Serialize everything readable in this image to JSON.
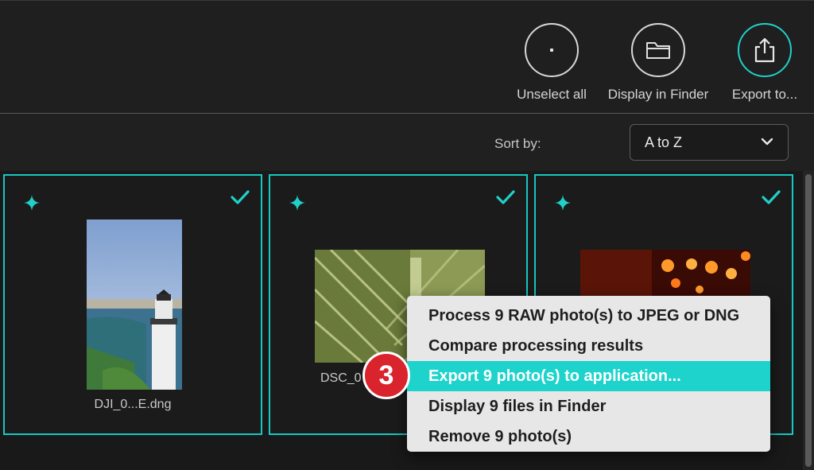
{
  "toolbar": {
    "unselect_label": "Unselect all",
    "finder_label": "Display in Finder",
    "export_label": "Export to..."
  },
  "sort": {
    "label": "Sort by:",
    "value": "A to Z"
  },
  "photos": [
    {
      "filename": "DJI_0...E.dng",
      "selected": true
    },
    {
      "filename": "DSC_0",
      "selected": true
    },
    {
      "filename": "",
      "selected": true
    }
  ],
  "context_menu": {
    "items": [
      "Process 9 RAW photo(s) to JPEG or DNG",
      "Compare processing results",
      "Export 9 photo(s) to application...",
      "Display 9 files in Finder",
      "Remove 9 photo(s)"
    ],
    "highlighted_index": 2
  },
  "step_badge": "3",
  "colors": {
    "accent": "#1fd1c8",
    "badge": "#d9232d",
    "background": "#1c1c1c"
  }
}
